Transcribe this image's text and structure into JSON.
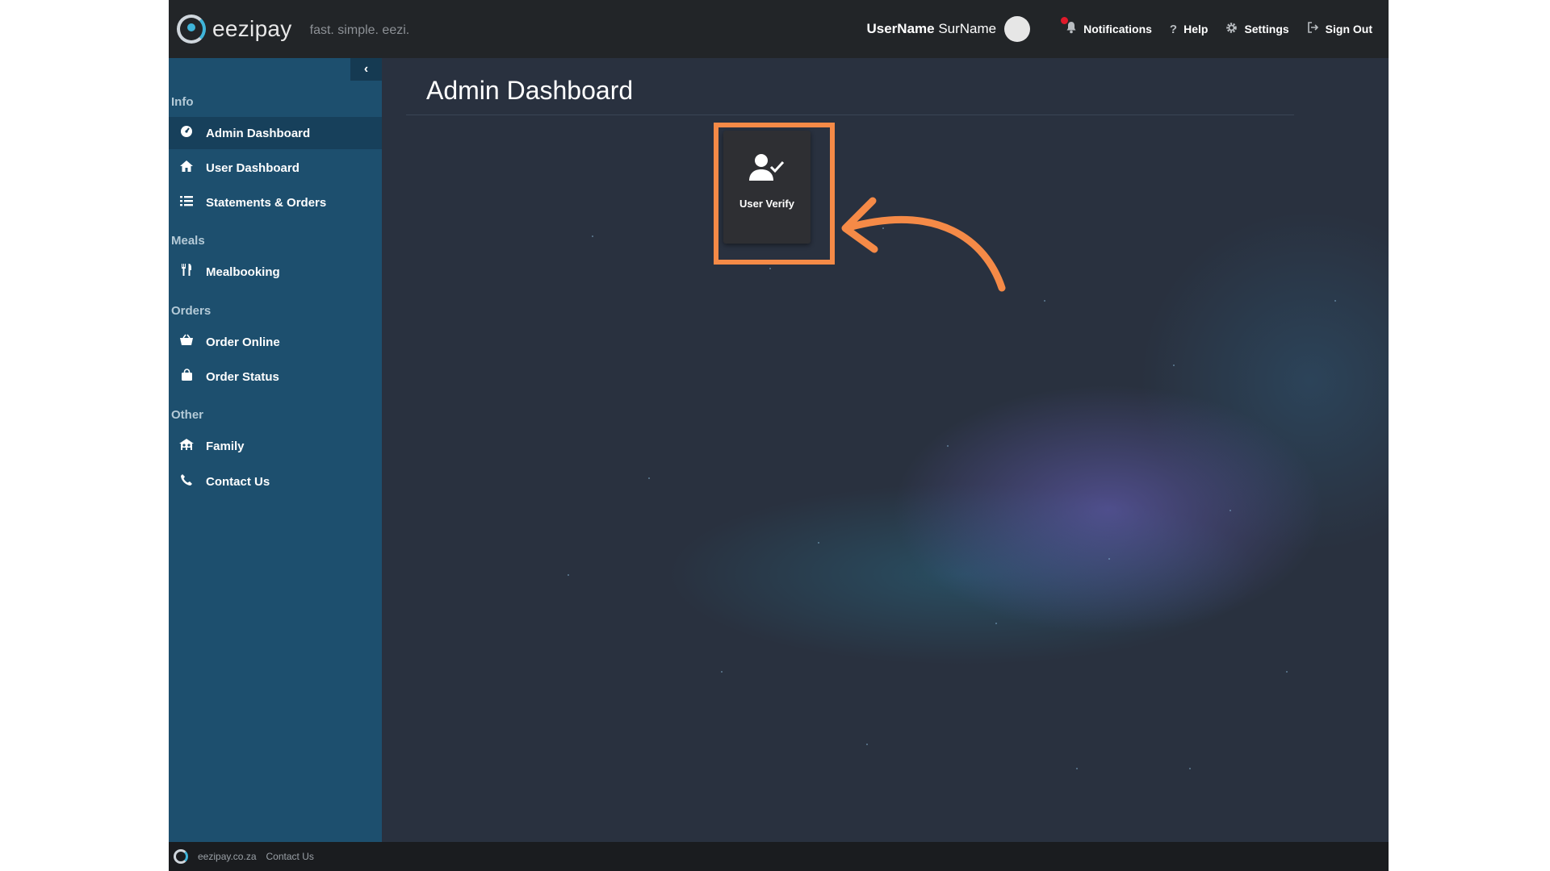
{
  "topbar": {
    "brand": "eezipay",
    "tagline": "fast. simple. eezi.",
    "user_first": "UserName",
    "user_last": "SurName",
    "notifications_label": "Notifications",
    "help_label": "Help",
    "settings_label": "Settings",
    "signout_label": "Sign Out",
    "help_glyph": "?"
  },
  "sidebar": {
    "collapse_glyph": "‹",
    "sections": [
      {
        "label": "Info"
      },
      {
        "label": "Meals"
      },
      {
        "label": "Orders"
      },
      {
        "label": "Other"
      }
    ],
    "items": [
      {
        "label": "Admin Dashboard",
        "icon": "dashboard-icon",
        "active": true
      },
      {
        "label": "User Dashboard",
        "icon": "home-icon"
      },
      {
        "label": "Statements & Orders",
        "icon": "list-icon"
      },
      {
        "label": "Mealbooking",
        "icon": "cutlery-icon"
      },
      {
        "label": "Order Online",
        "icon": "basket-icon"
      },
      {
        "label": "Order Status",
        "icon": "bag-icon"
      },
      {
        "label": "Family",
        "icon": "family-icon"
      },
      {
        "label": "Contact Us",
        "icon": "phone-icon"
      }
    ]
  },
  "main": {
    "title": "Admin Dashboard",
    "tiles": [
      {
        "label": "User Verify",
        "icon": "user-check-icon"
      }
    ]
  },
  "footer": {
    "site": "eezipay.co.za",
    "contact": "Contact Us"
  },
  "colors": {
    "highlight": "#f58a47",
    "sidebar": "#1d4f6e",
    "topbar": "#222528"
  }
}
